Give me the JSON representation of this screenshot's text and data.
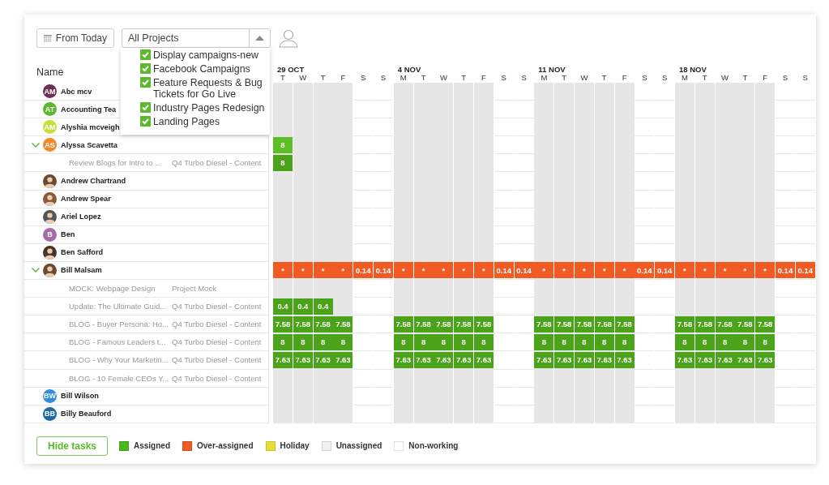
{
  "toolbar": {
    "from_today": "From Today",
    "project_select": {
      "value": "All Projects",
      "expanded": true,
      "options": [
        {
          "label": "Display campaigns-new",
          "checked": true
        },
        {
          "label": "Facebook Campaigns",
          "checked": true
        },
        {
          "label": "Feature Requests & Bug Tickets for Go Live",
          "checked": true
        },
        {
          "label": "Industry Pages Redesign",
          "checked": true
        },
        {
          "label": "Landing Pages",
          "checked": true
        }
      ]
    }
  },
  "name_header": "Name",
  "weeks": [
    {
      "label": "29 OCT",
      "days": [
        {
          "label": "T",
          "working": true
        },
        {
          "label": "W",
          "working": true
        },
        {
          "label": "T",
          "working": true
        },
        {
          "label": "F",
          "working": true
        },
        {
          "label": "S",
          "working": false
        },
        {
          "label": "S",
          "working": false
        }
      ]
    },
    {
      "label": "4 NOV",
      "days": [
        {
          "label": "M",
          "working": true
        },
        {
          "label": "T",
          "working": true
        },
        {
          "label": "W",
          "working": true
        },
        {
          "label": "T",
          "working": true
        },
        {
          "label": "F",
          "working": true
        },
        {
          "label": "S",
          "working": false
        },
        {
          "label": "S",
          "working": false
        }
      ]
    },
    {
      "label": "11 NOV",
      "days": [
        {
          "label": "M",
          "working": true
        },
        {
          "label": "T",
          "working": true
        },
        {
          "label": "W",
          "working": true
        },
        {
          "label": "T",
          "working": true
        },
        {
          "label": "F",
          "working": true
        },
        {
          "label": "S",
          "working": false
        },
        {
          "label": "S",
          "working": false
        }
      ]
    },
    {
      "label": "18 NOV",
      "days": [
        {
          "label": "M",
          "working": true
        },
        {
          "label": "T",
          "working": true
        },
        {
          "label": "W",
          "working": true
        },
        {
          "label": "T",
          "working": true
        },
        {
          "label": "F",
          "working": true
        },
        {
          "label": "S",
          "working": false
        },
        {
          "label": "S",
          "working": false
        }
      ]
    }
  ],
  "rows": [
    {
      "kind": "person",
      "name": "Abc mcv",
      "avatar": {
        "kind": "initials",
        "text": "AM",
        "color": "#6b2f55"
      },
      "expanded": false
    },
    {
      "kind": "person",
      "name": "Accounting Tea",
      "avatar": {
        "kind": "initials",
        "text": "AT",
        "color": "#5cb82e"
      },
      "expanded": false
    },
    {
      "kind": "person",
      "name": "Alyshia mcveigh",
      "avatar": {
        "kind": "initials",
        "text": "AM",
        "color": "#c6e03a"
      },
      "expanded": false
    },
    {
      "kind": "person",
      "name": "Alyssa Scavetta",
      "avatar": {
        "kind": "initials",
        "text": "AS",
        "color": "#f08a2c"
      },
      "expanded": true,
      "cells": [
        {
          "kind": "assigned",
          "text": "8"
        },
        null,
        null,
        null,
        null,
        null,
        null,
        null,
        null,
        null,
        null,
        null,
        null,
        null,
        null,
        null,
        null,
        null,
        null,
        null,
        null,
        null,
        null,
        null,
        null,
        null,
        null
      ]
    },
    {
      "kind": "task",
      "name": "Review Blogs for Intro to ...",
      "project": "Q4 Turbo Diesel - Content",
      "cells": [
        {
          "kind": "assigned",
          "text": "8"
        },
        null,
        null,
        null,
        null,
        null,
        null,
        null,
        null,
        null,
        null,
        null,
        null,
        null,
        null,
        null,
        null,
        null,
        null,
        null,
        null,
        null,
        null,
        null,
        null,
        null,
        null
      ]
    },
    {
      "kind": "person",
      "name": "Andrew Chartrand",
      "avatar": {
        "kind": "photo"
      },
      "expanded": false
    },
    {
      "kind": "person",
      "name": "Andrew Spear",
      "avatar": {
        "kind": "photo"
      },
      "expanded": false
    },
    {
      "kind": "person",
      "name": "Ariel Lopez",
      "avatar": {
        "kind": "photo"
      },
      "expanded": false
    },
    {
      "kind": "person",
      "name": "Ben",
      "avatar": {
        "kind": "initials",
        "text": "B",
        "color": "#a869a8"
      },
      "expanded": false
    },
    {
      "kind": "person",
      "name": "Ben Safford",
      "avatar": {
        "kind": "photo"
      },
      "expanded": false
    },
    {
      "kind": "person",
      "name": "Bill Malsam",
      "avatar": {
        "kind": "photo"
      },
      "expanded": true,
      "cells": [
        {
          "kind": "over",
          "text": "*"
        },
        {
          "kind": "over",
          "text": "*"
        },
        {
          "kind": "over",
          "text": "*"
        },
        {
          "kind": "over",
          "text": "*"
        },
        {
          "kind": "over",
          "text": "0.14"
        },
        {
          "kind": "over",
          "text": "0.14"
        },
        {
          "kind": "over",
          "text": "*"
        },
        {
          "kind": "over",
          "text": "*"
        },
        {
          "kind": "over",
          "text": "*"
        },
        {
          "kind": "over",
          "text": "*"
        },
        {
          "kind": "over",
          "text": "*"
        },
        {
          "kind": "over",
          "text": "0.14"
        },
        {
          "kind": "over",
          "text": "0.14"
        },
        {
          "kind": "over",
          "text": "*"
        },
        {
          "kind": "over",
          "text": "*"
        },
        {
          "kind": "over",
          "text": "*"
        },
        {
          "kind": "over",
          "text": "*"
        },
        {
          "kind": "over",
          "text": "*"
        },
        {
          "kind": "over",
          "text": "0.14"
        },
        {
          "kind": "over",
          "text": "0.14"
        },
        {
          "kind": "over",
          "text": "*"
        },
        {
          "kind": "over",
          "text": "*"
        },
        {
          "kind": "over",
          "text": "*"
        },
        {
          "kind": "over",
          "text": "*"
        },
        {
          "kind": "over",
          "text": "*"
        },
        {
          "kind": "over",
          "text": "0.14"
        },
        {
          "kind": "over",
          "text": "0.14"
        }
      ]
    },
    {
      "kind": "task",
      "name": "MOCK: Webpage Design",
      "project": "Project Mock"
    },
    {
      "kind": "task",
      "name": "Update: The Ultimate Guid...",
      "project": "Q4 Turbo Diesel - Content",
      "cells": [
        {
          "kind": "assigned",
          "text": "0.4"
        },
        {
          "kind": "assigned",
          "text": "0.4"
        },
        {
          "kind": "assigned",
          "text": "0.4"
        },
        null,
        null,
        null,
        null,
        null,
        null,
        null,
        null,
        null,
        null,
        null,
        null,
        null,
        null,
        null,
        null,
        null,
        null,
        null,
        null,
        null,
        null,
        null,
        null
      ]
    },
    {
      "kind": "task",
      "name": "BLOG - Buyer Persona: Ho...",
      "project": "Q4 Turbo Diesel - Content",
      "cells": [
        {
          "kind": "assigned",
          "text": "7.58"
        },
        {
          "kind": "assigned",
          "text": "7.58"
        },
        {
          "kind": "assigned",
          "text": "7.58"
        },
        {
          "kind": "assigned",
          "text": "7.58"
        },
        null,
        null,
        {
          "kind": "assigned",
          "text": "7.58"
        },
        {
          "kind": "assigned",
          "text": "7.58"
        },
        {
          "kind": "assigned",
          "text": "7.58"
        },
        {
          "kind": "assigned",
          "text": "7.58"
        },
        {
          "kind": "assigned",
          "text": "7.58"
        },
        null,
        null,
        {
          "kind": "assigned",
          "text": "7.58"
        },
        {
          "kind": "assigned",
          "text": "7.58"
        },
        {
          "kind": "assigned",
          "text": "7.58"
        },
        {
          "kind": "assigned",
          "text": "7.58"
        },
        {
          "kind": "assigned",
          "text": "7.58"
        },
        null,
        null,
        {
          "kind": "assigned",
          "text": "7.58"
        },
        {
          "kind": "assigned",
          "text": "7.58"
        },
        {
          "kind": "assigned",
          "text": "7.58"
        },
        {
          "kind": "assigned",
          "text": "7.58"
        },
        {
          "kind": "assigned",
          "text": "7.58"
        },
        null,
        null
      ]
    },
    {
      "kind": "task",
      "name": "BLOG - Famous Leaders t...",
      "project": "Q4 Turbo Diesel - Content",
      "cells": [
        {
          "kind": "assigned",
          "text": "8"
        },
        {
          "kind": "assigned",
          "text": "8"
        },
        {
          "kind": "assigned",
          "text": "8"
        },
        {
          "kind": "assigned",
          "text": "8"
        },
        null,
        null,
        {
          "kind": "assigned",
          "text": "8"
        },
        {
          "kind": "assigned",
          "text": "8"
        },
        {
          "kind": "assigned",
          "text": "8"
        },
        {
          "kind": "assigned",
          "text": "8"
        },
        {
          "kind": "assigned",
          "text": "8"
        },
        null,
        null,
        {
          "kind": "assigned",
          "text": "8"
        },
        {
          "kind": "assigned",
          "text": "8"
        },
        {
          "kind": "assigned",
          "text": "8"
        },
        {
          "kind": "assigned",
          "text": "8"
        },
        {
          "kind": "assigned",
          "text": "8"
        },
        null,
        null,
        {
          "kind": "assigned",
          "text": "8"
        },
        {
          "kind": "assigned",
          "text": "8"
        },
        {
          "kind": "assigned",
          "text": "8"
        },
        {
          "kind": "assigned",
          "text": "8"
        },
        {
          "kind": "assigned",
          "text": "8"
        },
        null,
        null
      ]
    },
    {
      "kind": "task",
      "name": "BLOG - Why Your Marketin...",
      "project": "Q4 Turbo Diesel - Content",
      "cells": [
        {
          "kind": "assigned",
          "text": "7.63"
        },
        {
          "kind": "assigned",
          "text": "7.63"
        },
        {
          "kind": "assigned",
          "text": "7.63"
        },
        {
          "kind": "assigned",
          "text": "7.63"
        },
        null,
        null,
        {
          "kind": "assigned",
          "text": "7.63"
        },
        {
          "kind": "assigned",
          "text": "7.63"
        },
        {
          "kind": "assigned",
          "text": "7.63"
        },
        {
          "kind": "assigned",
          "text": "7.63"
        },
        {
          "kind": "assigned",
          "text": "7.63"
        },
        null,
        null,
        {
          "kind": "assigned",
          "text": "7.63"
        },
        {
          "kind": "assigned",
          "text": "7.63"
        },
        {
          "kind": "assigned",
          "text": "7.63"
        },
        {
          "kind": "assigned",
          "text": "7.63"
        },
        {
          "kind": "assigned",
          "text": "7.63"
        },
        null,
        null,
        {
          "kind": "assigned",
          "text": "7.63"
        },
        {
          "kind": "assigned",
          "text": "7.63"
        },
        {
          "kind": "assigned",
          "text": "7.63"
        },
        {
          "kind": "assigned",
          "text": "7.63"
        },
        {
          "kind": "assigned",
          "text": "7.63"
        },
        null,
        null
      ]
    },
    {
      "kind": "task",
      "name": "BLOG - 10 Female CEOs Y...",
      "project": "Q4 Turbo Diesel - Content"
    },
    {
      "kind": "person",
      "name": "Bill Wilson",
      "avatar": {
        "kind": "initials",
        "text": "BW",
        "color": "#2f8ee0"
      },
      "expanded": false
    },
    {
      "kind": "person",
      "name": "Billy Beauford",
      "avatar": {
        "kind": "initials",
        "text": "BB",
        "color": "#1f6aa5"
      },
      "expanded": false
    }
  ],
  "footer": {
    "hide_tasks": "Hide tasks",
    "legend": [
      {
        "label": "Assigned",
        "color": "#4cb51f"
      },
      {
        "label": "Over-assigned",
        "color": "#f05a24"
      },
      {
        "label": "Holiday",
        "color": "#e5dc3a"
      },
      {
        "label": "Unassigned",
        "color": "#f0f0f0"
      },
      {
        "label": "Non-working",
        "color": "#ffffff"
      }
    ]
  }
}
